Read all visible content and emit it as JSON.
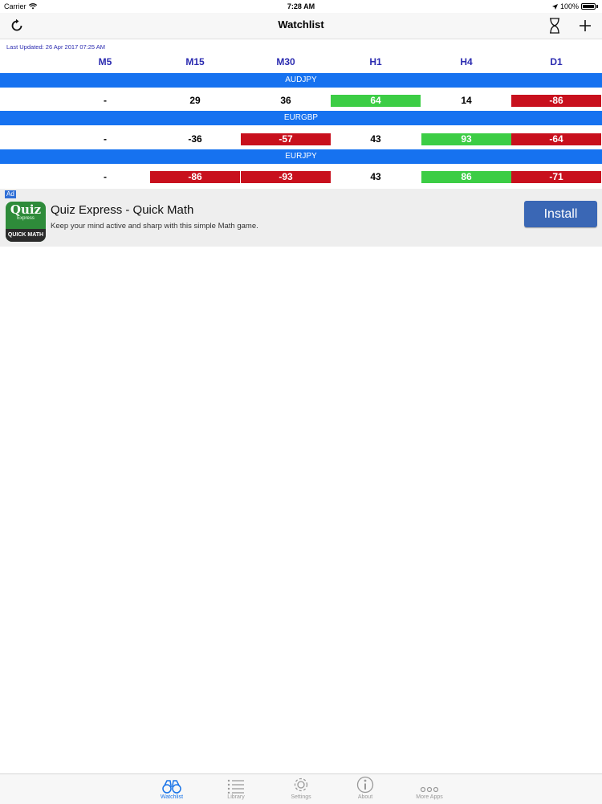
{
  "status_bar": {
    "carrier": "Carrier",
    "time": "7:28 AM",
    "battery": "100%"
  },
  "nav": {
    "title": "Watchlist",
    "refresh_icon": "refresh-icon",
    "right_icons": [
      "hourglass-icon",
      "plus-icon"
    ]
  },
  "last_updated": "Last Updated: 26 Apr 2017 07:25 AM",
  "columns": [
    "M5",
    "M15",
    "M30",
    "H1",
    "H4",
    "D1"
  ],
  "pairs": [
    {
      "name": "AUDJPY",
      "values": [
        "-",
        "29",
        "36",
        "64",
        "14",
        "-86"
      ],
      "status": [
        "plain",
        "plain",
        "plain",
        "green",
        "plain",
        "red"
      ]
    },
    {
      "name": "EURGBP",
      "values": [
        "-",
        "-36",
        "-57",
        "43",
        "93",
        "-64"
      ],
      "status": [
        "plain",
        "plain",
        "red",
        "plain",
        "green",
        "red"
      ]
    },
    {
      "name": "EURJPY",
      "values": [
        "-",
        "-86",
        "-93",
        "43",
        "86",
        "-71"
      ],
      "status": [
        "plain",
        "red",
        "red",
        "plain",
        "green",
        "red"
      ]
    }
  ],
  "ad": {
    "badge": "Ad",
    "icon_title": "Quiz",
    "icon_sub": "Express",
    "icon_banner": "QUICK MATH",
    "title": "Quiz Express - Quick Math",
    "subtitle": "Keep your mind active and sharp with this simple Math game.",
    "button": "Install"
  },
  "tabs": [
    {
      "label": "Watchlist",
      "icon": "binoculars-icon",
      "active": true
    },
    {
      "label": "Library",
      "icon": "list-icon",
      "active": false
    },
    {
      "label": "Settings",
      "icon": "gear-icon",
      "active": false
    },
    {
      "label": "About",
      "icon": "info-icon",
      "active": false
    },
    {
      "label": "More Apps",
      "icon": "more-icon",
      "active": false
    }
  ],
  "colors": {
    "accent": "#1a74e8",
    "pair_bar": "#1672f0",
    "up": "#3ccd45",
    "down": "#c8101d",
    "header_text": "#2b2bb0"
  }
}
